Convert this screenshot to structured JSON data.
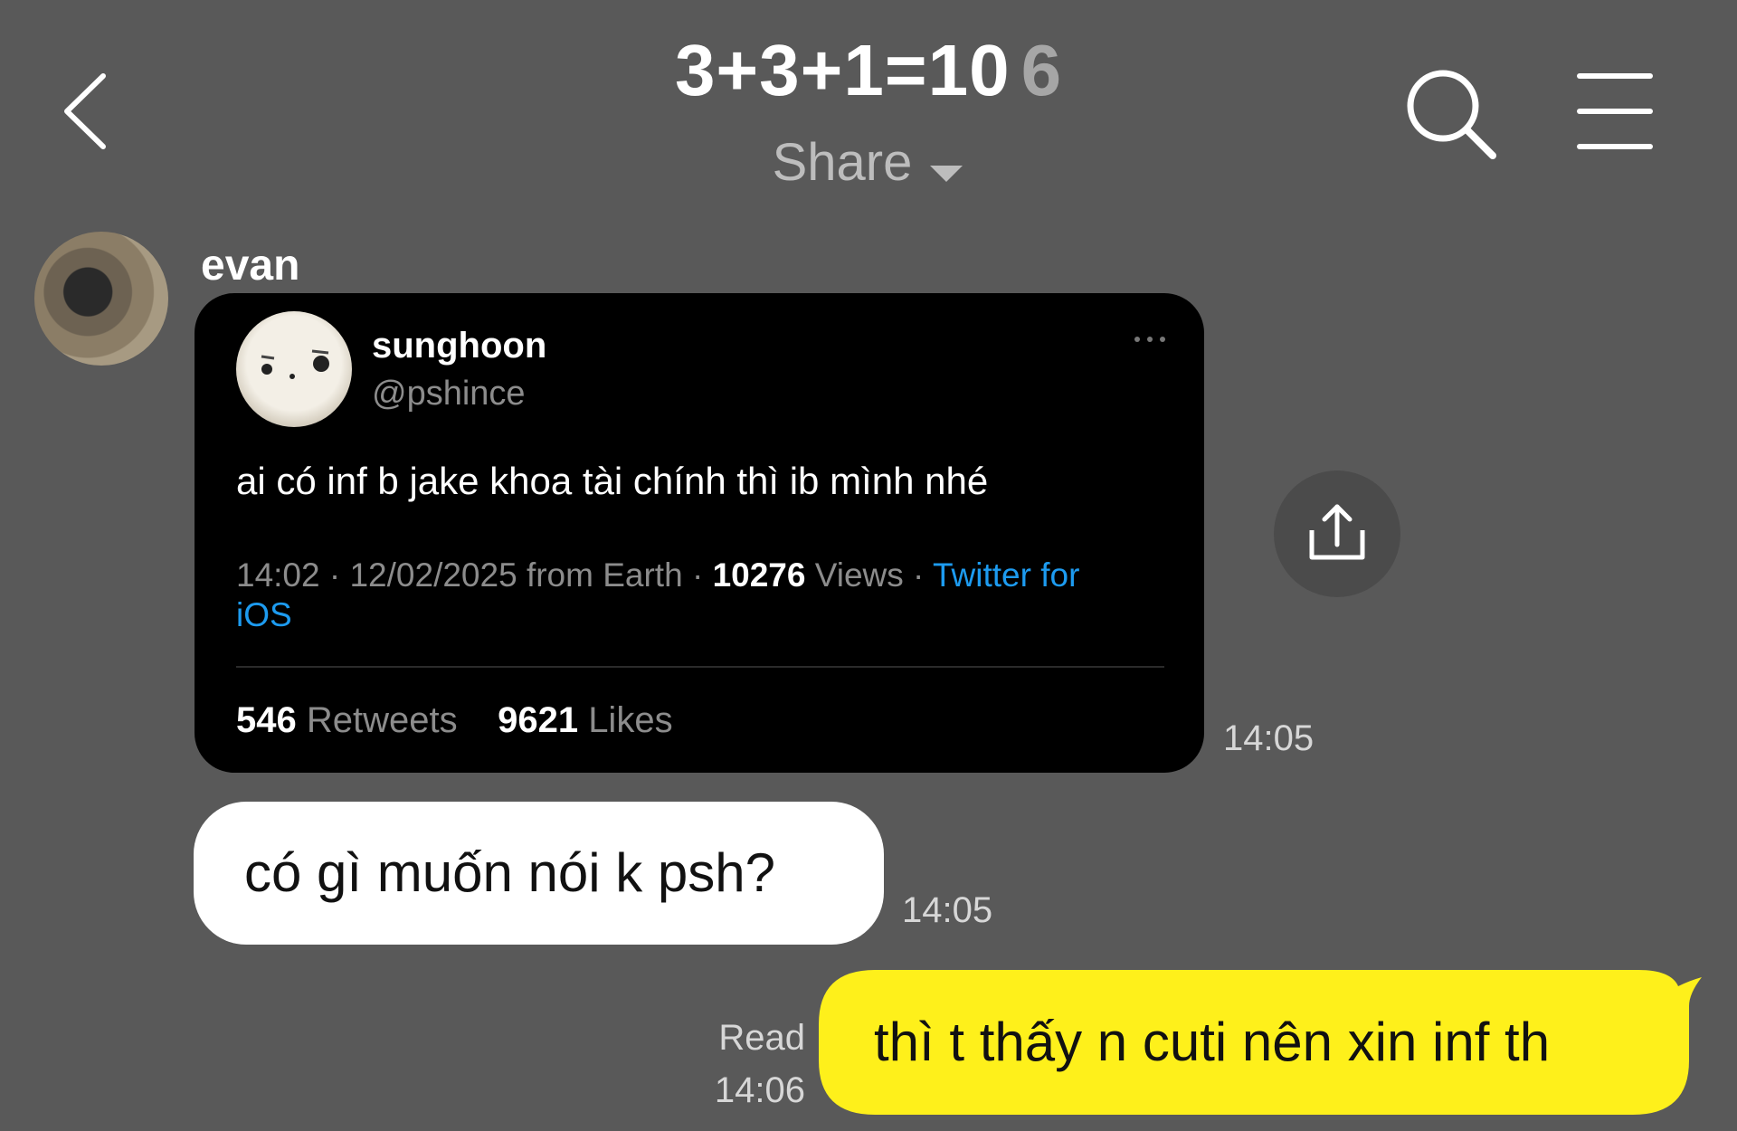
{
  "header": {
    "title": "3+3+1=10",
    "member_count": "6",
    "subtitle": "Share"
  },
  "messages": {
    "incoming": {
      "sender": "evan",
      "tweet": {
        "name": "sunghoon",
        "handle": "@pshince",
        "text": "ai có inf b jake khoa tài chính thì ib mình nhé",
        "time": "14:02",
        "date": "12/02/2025",
        "location": "from Earth",
        "views": "10276",
        "views_label": "Views",
        "client": "Twitter for iOS",
        "retweets": "546",
        "retweets_label": "Retweets",
        "likes": "9621",
        "likes_label": "Likes"
      },
      "tweet_time": "14:05",
      "text": "có gì muốn nói k psh?",
      "text_time": "14:05"
    },
    "outgoing": {
      "status": "Read",
      "time": "14:06",
      "text": "thì t thấy n cuti nên xin inf th"
    }
  },
  "colors": {
    "background": "#595959",
    "tweet_card": "#000000",
    "twitter_link": "#1d9bf0",
    "outgoing_bubble": "#fef01b",
    "incoming_bubble": "#ffffff"
  },
  "icons": {
    "back": "chevron-left-icon",
    "search": "search-icon",
    "menu": "hamburger-menu-icon",
    "share": "upload-share-icon",
    "more": "more-dots-icon",
    "dropdown": "caret-down-icon"
  }
}
